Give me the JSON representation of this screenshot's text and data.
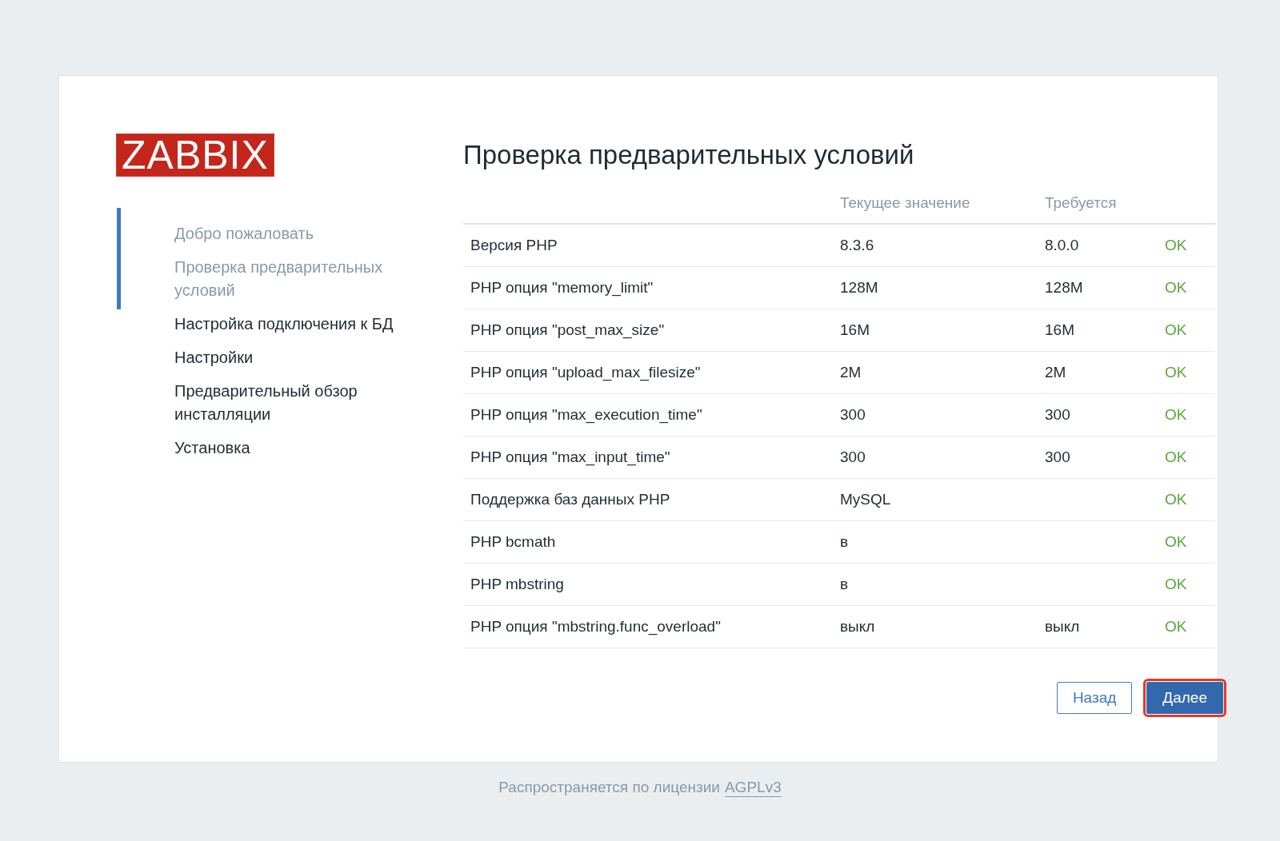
{
  "logo": "ZABBIX",
  "steps": [
    {
      "label": "Добро пожаловать",
      "visited": true
    },
    {
      "label": "Проверка предварительных условий",
      "visited": true
    },
    {
      "label": "Настройка подключения к БД",
      "visited": false
    },
    {
      "label": "Настройки",
      "visited": false
    },
    {
      "label": "Предварительный обзор инсталляции",
      "visited": false
    },
    {
      "label": "Установка",
      "visited": false
    }
  ],
  "title": "Проверка предварительных условий",
  "table": {
    "columns": [
      "Текущее значение",
      "Требуется"
    ],
    "rows": [
      {
        "name": "Версия PHP",
        "current": "8.3.6",
        "required": "8.0.0",
        "status": "OK",
        "passed": true
      },
      {
        "name": "PHP опция \"memory_limit\"",
        "current": "128M",
        "required": "128M",
        "status": "OK",
        "passed": true
      },
      {
        "name": "PHP опция \"post_max_size\"",
        "current": "16M",
        "required": "16M",
        "status": "OK",
        "passed": true
      },
      {
        "name": "PHP опция \"upload_max_filesize\"",
        "current": "2M",
        "required": "2M",
        "status": "OK",
        "passed": true
      },
      {
        "name": "PHP опция \"max_execution_time\"",
        "current": "300",
        "required": "300",
        "status": "OK",
        "passed": true
      },
      {
        "name": "PHP опция \"max_input_time\"",
        "current": "300",
        "required": "300",
        "status": "OK",
        "passed": true
      },
      {
        "name": "Поддержка баз данных PHP",
        "current": "MySQL",
        "status": "OK",
        "passed": true
      },
      {
        "name": "PHP bcmath",
        "current": "в",
        "status": "OK",
        "passed": true
      },
      {
        "name": "PHP mbstring",
        "current": "в",
        "status": "OK",
        "passed": true
      },
      {
        "name": "PHP опция \"mbstring.func_overload\"",
        "current": "выкл",
        "required": "выкл",
        "status": "OK",
        "passed": true
      }
    ]
  },
  "buttons": [
    {
      "label": "Назад",
      "kind": "secondary",
      "highlighted": false
    },
    {
      "label": "Далее",
      "kind": "primary",
      "highlighted": true
    }
  ],
  "footer": {
    "text": "Распространяется по лицензии",
    "link": "AGPLv3"
  }
}
